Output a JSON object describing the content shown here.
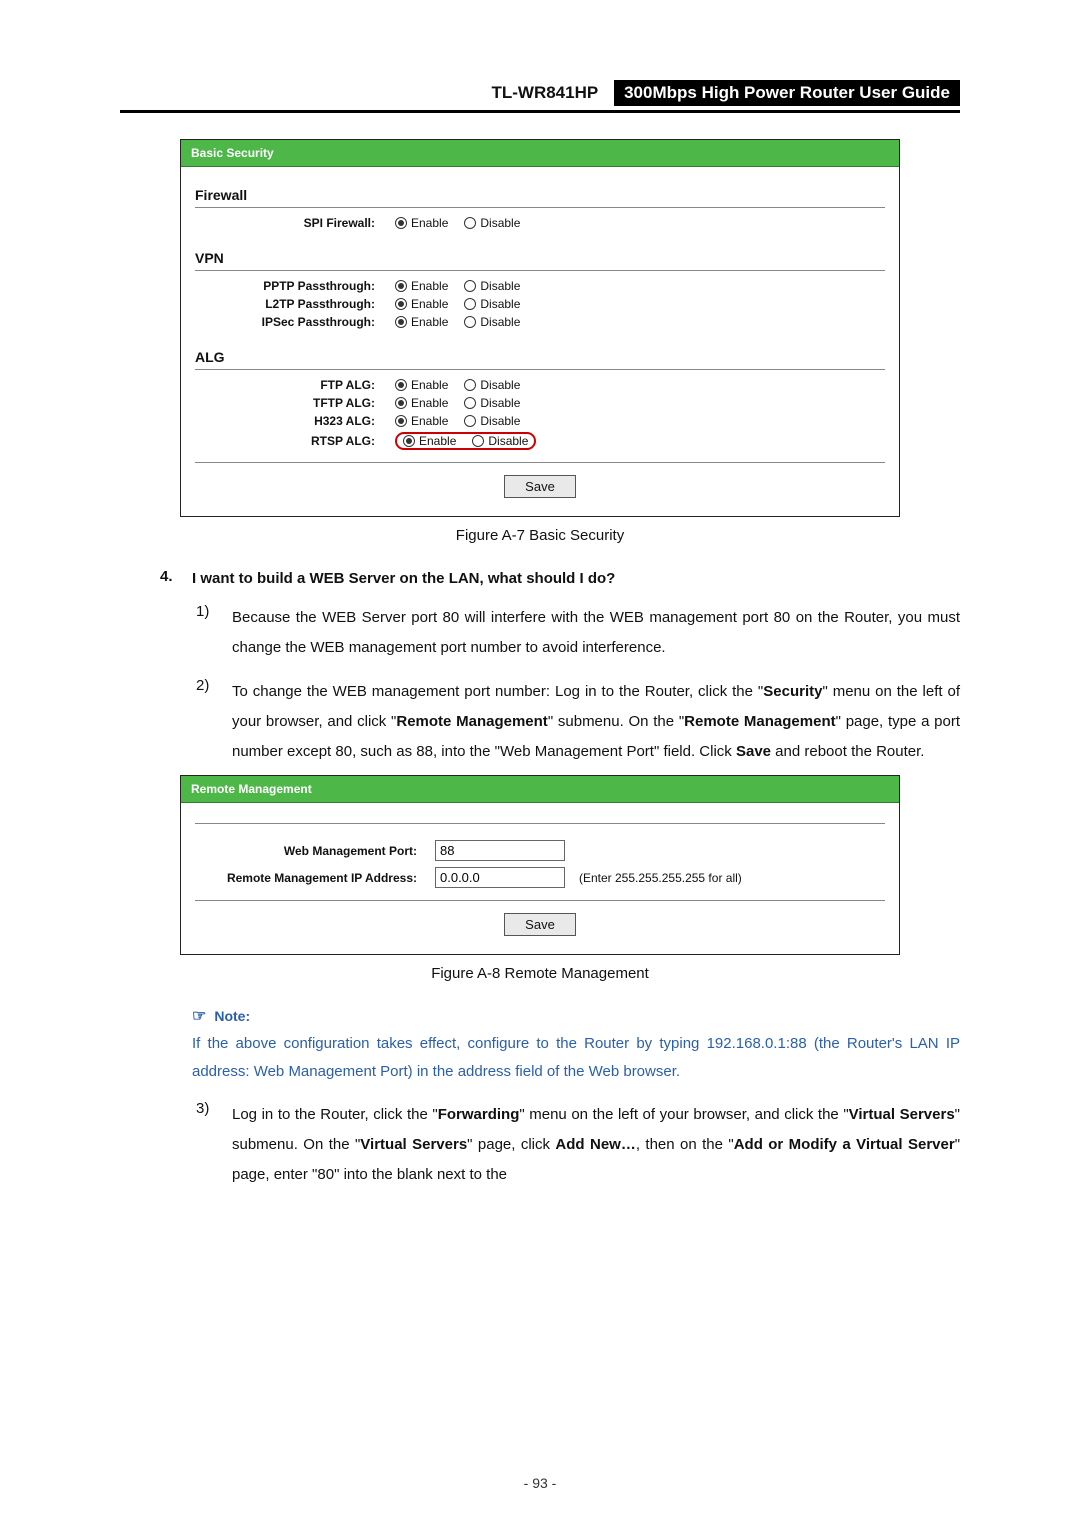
{
  "header": {
    "model": "TL-WR841HP",
    "title": "300Mbps High Power Router User Guide"
  },
  "fig_a7": {
    "panel_title": "Basic Security",
    "caption": "Figure A-7    Basic Security",
    "save": "Save",
    "enable": "Enable",
    "disable": "Disable",
    "sections": {
      "firewall": {
        "title": "Firewall",
        "rows": [
          {
            "label": "SPI Firewall:"
          }
        ]
      },
      "vpn": {
        "title": "VPN",
        "rows": [
          {
            "label": "PPTP Passthrough:"
          },
          {
            "label": "L2TP Passthrough:"
          },
          {
            "label": "IPSec Passthrough:"
          }
        ]
      },
      "alg": {
        "title": "ALG",
        "rows": [
          {
            "label": "FTP ALG:"
          },
          {
            "label": "TFTP ALG:"
          },
          {
            "label": "H323 ALG:"
          },
          {
            "label": "RTSP ALG:"
          }
        ]
      }
    }
  },
  "question4": {
    "num": "4.",
    "text": "I want to build a WEB Server on the LAN, what should I do?",
    "step1": {
      "num": "1)",
      "text": "Because the WEB Server port 80 will interfere with the WEB management port 80 on the Router, you must change the WEB management port number to avoid interference."
    },
    "step2": {
      "num": "2)",
      "pre": "To change the WEB management port number: Log in to the Router, click the \"",
      "b1": "Security",
      "mid1": "\" menu on the left of your browser, and click \"",
      "b2": "Remote Management",
      "mid2": "\" submenu. On the \"",
      "b3": "Remote Management",
      "mid3": "\" page, type a port number except 80, such as 88, into the \"Web Management Port\" field. Click ",
      "b4": "Save",
      "post": " and reboot the Router."
    },
    "step3": {
      "num": "3)",
      "pre": "Log in to the Router, click the \"",
      "b1": "Forwarding",
      "mid1": "\" menu on the left of your browser, and click the \"",
      "b2": "Virtual Servers",
      "mid2": "\" submenu. On the \"",
      "b3": "Virtual Servers",
      "mid3": "\" page, click ",
      "b4": "Add New…",
      "mid4": ", then on the \"",
      "b5": "Add or Modify a Virtual Server",
      "post": "\" page, enter \"80\" into the blank next to the"
    }
  },
  "fig_a8": {
    "panel_title": "Remote Management",
    "caption": "Figure A-8    Remote Management",
    "save": "Save",
    "rows": {
      "port_label": "Web Management Port:",
      "port_value": "88",
      "ip_label": "Remote Management IP Address:",
      "ip_value": "0.0.0.0",
      "ip_hint": "(Enter 255.255.255.255 for all)"
    }
  },
  "note": {
    "head": "Note:",
    "text": "If the above configuration takes effect, configure to the Router by typing 192.168.0.1:88 (the Router's LAN IP address: Web Management Port) in the address field of the Web browser."
  },
  "page_number": "- 93 -"
}
